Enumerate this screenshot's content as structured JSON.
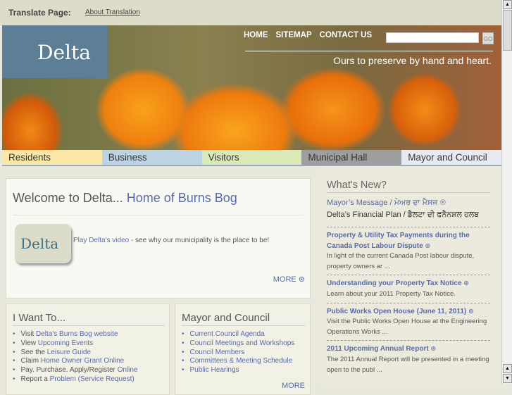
{
  "topbar": {
    "translate_label": "Translate Page:",
    "about_link": "About Translation"
  },
  "banner": {
    "logo": "Delta",
    "nav": [
      "HOME",
      "SITEMAP",
      "CONTACT US"
    ],
    "search_placeholder": "",
    "go": "GO",
    "tagline": "Ours to preserve by hand and heart."
  },
  "tabs": [
    {
      "label": "Residents",
      "color": "#fbe7a6"
    },
    {
      "label": "Business",
      "color": "#bcd3e4"
    },
    {
      "label": "Visitors",
      "color": "#d9e9b8"
    },
    {
      "label": "Municipal Hall",
      "color": "#9e9e9e"
    },
    {
      "label": "Mayor and Council",
      "color": "#e6ebf3"
    }
  ],
  "welcome": {
    "title_plain": "Welcome to Delta... ",
    "title_link": "Home of Burns Bog",
    "video_logo": "Delta",
    "video_link": "Play Delta's video",
    "video_text": " - see why our municipality is the place to be!",
    "more": "MORE"
  },
  "iwant": {
    "title": "I Want To...",
    "items": [
      {
        "pre": "Visit ",
        "link": "Delta's Burns Bog website"
      },
      {
        "pre": "View ",
        "link": "Upcoming Events"
      },
      {
        "pre": "See the ",
        "link": "Leisure Guide"
      },
      {
        "pre": "Claim ",
        "link": "Home Owner Grant Online"
      },
      {
        "pre": "Pay. Purchase. Apply/Register ",
        "link": "Online"
      },
      {
        "pre": "Report a ",
        "link": "Problem (Service Request)"
      }
    ]
  },
  "council": {
    "title": "Mayor and Council",
    "items": [
      "Current Council Agenda",
      "Council Meetings and Workshops",
      "Council Members",
      "Committees & Meeting Schedule",
      "Public Hearings"
    ],
    "more": "MORE"
  },
  "whatsnew": {
    "title": "What's New?",
    "mayor_msg": "Mayor’s Message / ਮੇਅਰ ਦਾ ਮੈਸਜ",
    "financial": "Delta’s Financial Plan / ਡੈਲਟਾ ਦੀ ਫਨੈਨਸ਼ਲ ਹਲਬ",
    "items": [
      {
        "title": "Property & Utility Tax Payments during the Canada Post Labour Dispute",
        "desc": "In light of the current Canada Post labour dispute, property owners ar ..."
      },
      {
        "title": "Understanding your Property Tax Notice",
        "desc": "Learn about your 2011 Property Tax Notice."
      },
      {
        "title": "Public Works Open House (June 11, 2011)",
        "desc": "Visit the Public Works Open House at the Engineering Operations Works ..."
      },
      {
        "title": "2011 Upcoming Annual Report",
        "desc": "The 2011 Annual Report will be presented in a meeting open to the publ ..."
      }
    ]
  }
}
